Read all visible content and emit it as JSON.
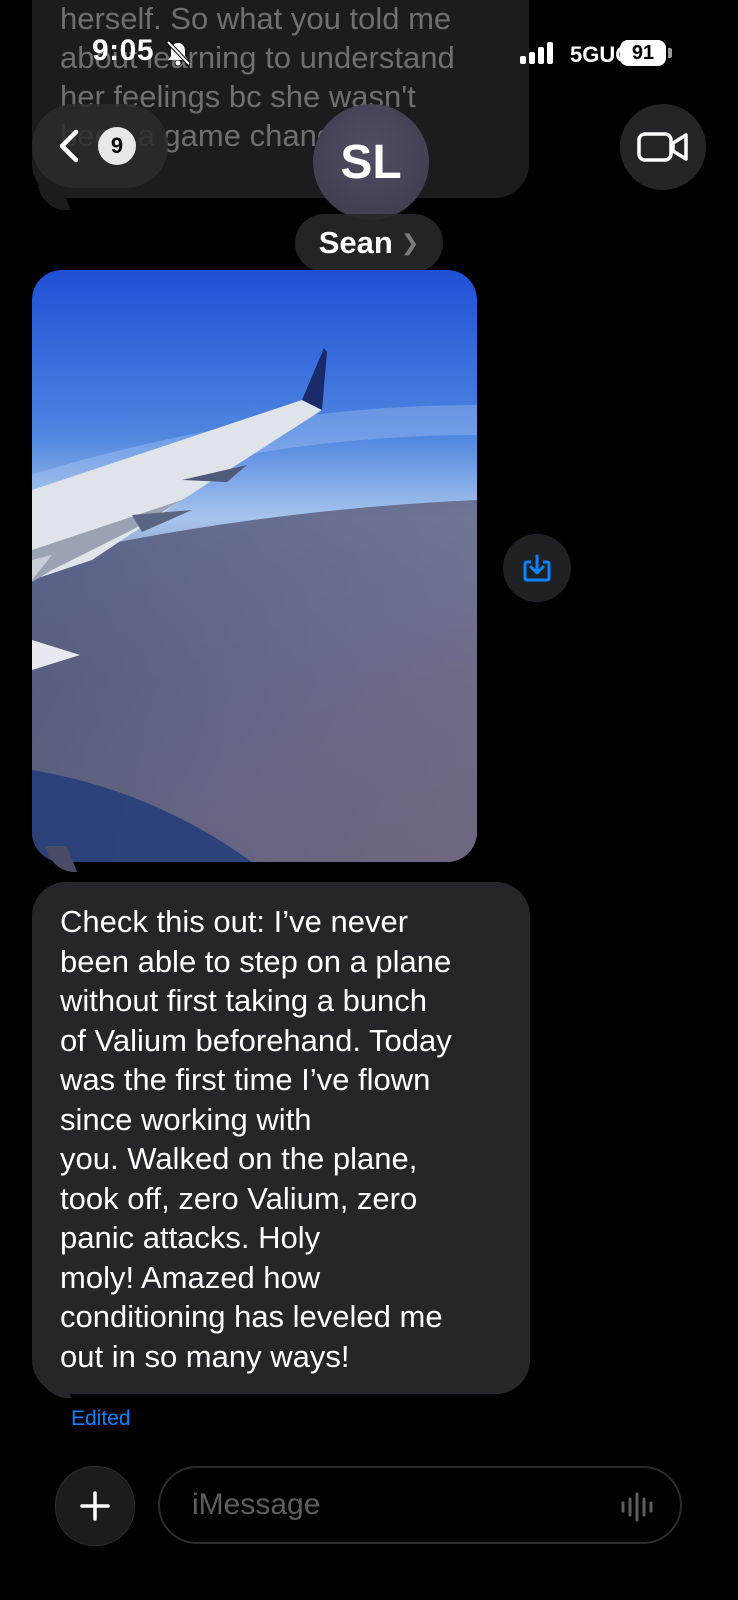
{
  "status_bar": {
    "time": "9:05",
    "network": "5GUC",
    "battery": "91"
  },
  "previous_message": {
    "text": "called it; she def was lying to\nherself. So what you told me\nabout learning to understand\nher feelings bc she wasn't\nbeen a game changer."
  },
  "header": {
    "back_badge": "9",
    "avatar_initials": "SL",
    "contact_name": "Sean"
  },
  "message": {
    "text": "Check this out:  I’ve never\nbeen able to step on a plane\nwithout first taking a bunch\nof Valium beforehand.  Today\nwas the first time I’ve flown\nsince working with\nyou.  Walked on the plane,\ntook off, zero Valium, zero\npanic attacks.  Holy\nmoly!  Amazed how\nconditioning has leveled me\nout in so many ways!",
    "status": "Edited"
  },
  "composer": {
    "placeholder": "iMessage"
  },
  "colors": {
    "accent": "#0a84ff",
    "incoming_bubble": "#26262a",
    "background": "#000000"
  },
  "icons": [
    "bell-slash-icon",
    "signal-icon",
    "battery-icon",
    "chevron-left-icon",
    "video-camera-icon",
    "save-download-icon",
    "plus-icon",
    "waveform-icon"
  ]
}
